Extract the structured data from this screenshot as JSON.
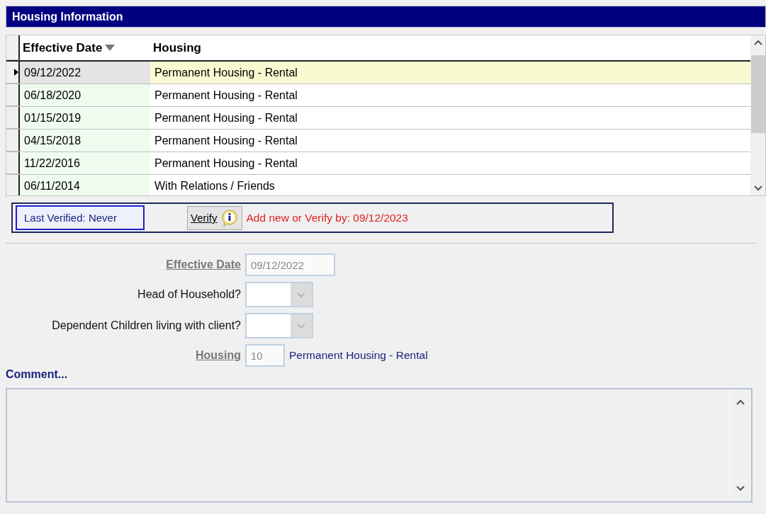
{
  "title": "Housing Information",
  "table": {
    "columns": [
      {
        "label": "Effective Date",
        "sorted": true
      },
      {
        "label": "Housing",
        "sorted": false
      }
    ],
    "rows": [
      {
        "date": "09/12/2022",
        "housing": "Permanent Housing - Rental",
        "selected": true
      },
      {
        "date": "06/18/2020",
        "housing": "Permanent Housing - Rental",
        "selected": false
      },
      {
        "date": "01/15/2019",
        "housing": "Permanent Housing - Rental",
        "selected": false
      },
      {
        "date": "04/15/2018",
        "housing": "Permanent Housing - Rental",
        "selected": false
      },
      {
        "date": "11/22/2016",
        "housing": "Permanent Housing - Rental",
        "selected": false
      },
      {
        "date": "06/11/2014",
        "housing": "With Relations / Friends",
        "selected": false
      }
    ]
  },
  "verify": {
    "last_verified": "Last Verified: Never",
    "button": "Verify",
    "due": "Add new or Verify by: 09/12/2023"
  },
  "fields": [
    {
      "kind": "text",
      "label": "Effective Date",
      "underlined": true,
      "value": "09/12/2022"
    },
    {
      "kind": "combo",
      "label": "Head of Household?",
      "underlined": false
    },
    {
      "kind": "combo",
      "label": "Dependent Children living with client?",
      "underlined": false
    },
    {
      "kind": "code",
      "label": "Housing",
      "underlined": true,
      "value": "10",
      "description": "Permanent Housing - Rental"
    }
  ],
  "comment": {
    "label": "Comment..."
  }
}
